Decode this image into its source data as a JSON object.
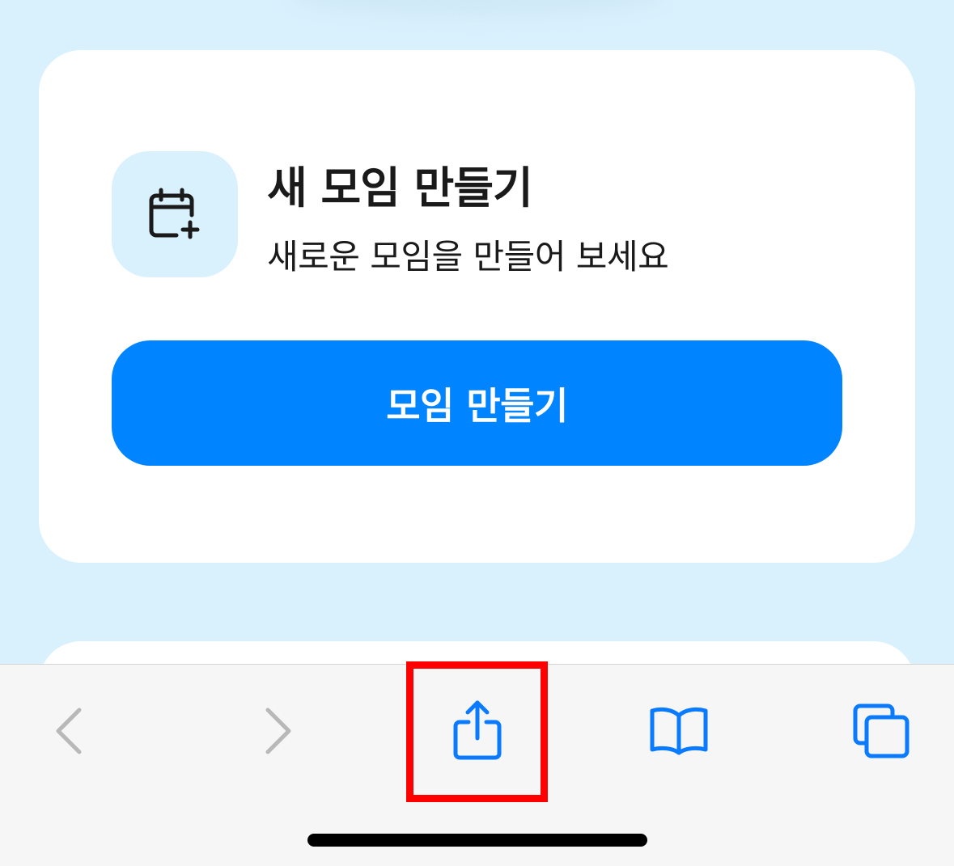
{
  "card": {
    "title": "새 모임 만들기",
    "subtitle": "새로운 모임을 만들어 보세요",
    "icon": "calendar-plus-icon",
    "button_label": "모임 만들기"
  },
  "toolbar": {
    "items": [
      {
        "icon": "chevron-left-icon",
        "enabled": false
      },
      {
        "icon": "chevron-right-icon",
        "enabled": false
      },
      {
        "icon": "share-icon",
        "enabled": true,
        "highlighted": true
      },
      {
        "icon": "book-icon",
        "enabled": true
      },
      {
        "icon": "tabs-icon",
        "enabled": true
      }
    ]
  },
  "colors": {
    "background": "#d9f1fd",
    "primary": "#0184ff",
    "toolbar_accent": "#0a7aff",
    "disabled": "#b8b8b8",
    "highlight": "#ff0000"
  }
}
